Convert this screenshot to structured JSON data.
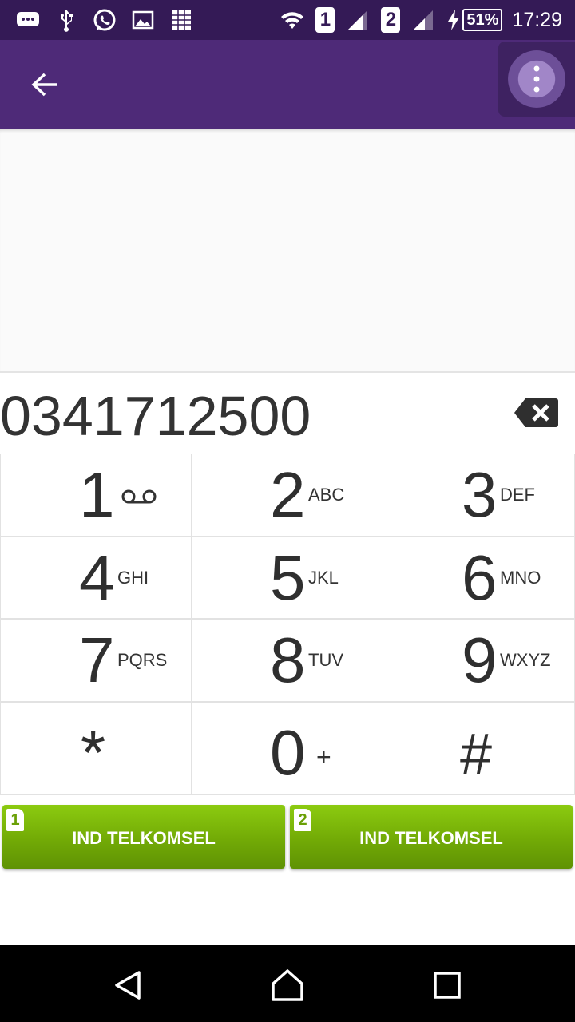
{
  "status_bar": {
    "icons_left": [
      "message-icon",
      "usb-icon",
      "whatsapp-icon",
      "image-icon",
      "screenshot-icon"
    ],
    "sim1_label": "1",
    "sim2_label": "2",
    "battery_text": "51%",
    "clock": "17:29"
  },
  "app_bar": {
    "back_icon": "arrow-left-icon",
    "overflow_icon": "more-vertical-icon"
  },
  "dialer": {
    "number": "0341712500"
  },
  "keypad": {
    "keys": [
      {
        "digit": "1",
        "letters": ""
      },
      {
        "digit": "2",
        "letters": "ABC"
      },
      {
        "digit": "3",
        "letters": "DEF"
      },
      {
        "digit": "4",
        "letters": "GHI"
      },
      {
        "digit": "5",
        "letters": "JKL"
      },
      {
        "digit": "6",
        "letters": "MNO"
      },
      {
        "digit": "7",
        "letters": "PQRS"
      },
      {
        "digit": "8",
        "letters": "TUV"
      },
      {
        "digit": "9",
        "letters": "WXYZ"
      },
      {
        "digit": "*",
        "letters": ""
      },
      {
        "digit": "0",
        "letters": "+"
      },
      {
        "digit": "#",
        "letters": ""
      }
    ]
  },
  "call_buttons": [
    {
      "sim": "1",
      "label": "IND TELKOMSEL"
    },
    {
      "sim": "2",
      "label": "IND TELKOMSEL"
    }
  ],
  "colors": {
    "status_bar": "#341a56",
    "app_bar": "#4e2a78",
    "call_button": "#7ab80a"
  }
}
